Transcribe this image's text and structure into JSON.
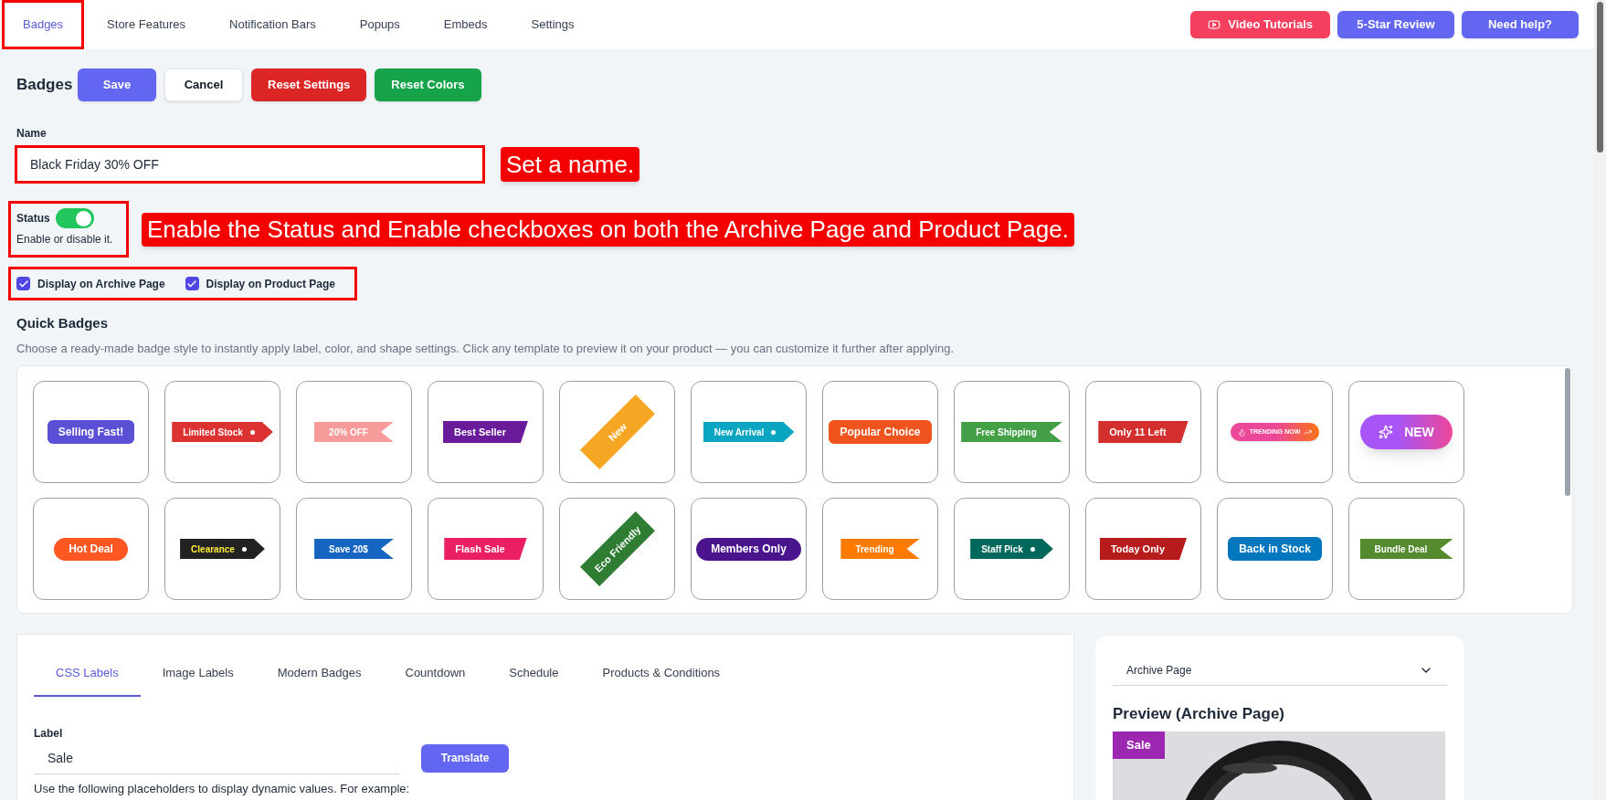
{
  "top_tabs": [
    {
      "label": "Badges",
      "selected": true,
      "highlighted": true
    },
    {
      "label": "Store Features",
      "selected": false,
      "highlighted": false
    },
    {
      "label": "Notification Bars",
      "selected": false,
      "highlighted": false
    },
    {
      "label": "Popups",
      "selected": false,
      "highlighted": false
    },
    {
      "label": "Embeds",
      "selected": false,
      "highlighted": false
    },
    {
      "label": "Settings",
      "selected": false,
      "highlighted": false
    }
  ],
  "top_buttons": [
    {
      "label": "Video Tutorials",
      "kind": "video",
      "color": "#f43f5e"
    },
    {
      "label": "5-Star Review",
      "kind": "plain",
      "color": "#6366f1"
    },
    {
      "label": "Need help?",
      "kind": "plain",
      "color": "#6366f1"
    }
  ],
  "page_title": "Badges",
  "actions": [
    {
      "label": "Save",
      "kind": "primary"
    },
    {
      "label": "Cancel",
      "kind": "secondary"
    },
    {
      "label": "Reset Settings",
      "kind": "danger"
    },
    {
      "label": "Reset Colors",
      "kind": "success"
    }
  ],
  "name_field": {
    "label": "Name",
    "value": "Black Friday 30% OFF",
    "highlighted": true
  },
  "name_callout": "Set a name.",
  "status": {
    "label": "Status",
    "on": true,
    "hint": "Enable or disable it.",
    "highlighted": true
  },
  "status_callout": "Enable the Status and Enable checkboxes on both the Archive Page and Product Page.",
  "display_options": {
    "highlighted": true,
    "items": [
      {
        "label": "Display on Archive Page",
        "checked": true
      },
      {
        "label": "Display on Product Page",
        "checked": true
      }
    ]
  },
  "quick_badges": {
    "title": "Quick Badges",
    "description": "Choose a ready-made badge style to instantly apply label, color, and shape settings. Click any template to preview it on your product — you can customize it further after applying.",
    "badges": [
      {
        "label": "Selling Fast!",
        "kind": "rounded",
        "color": "#5b4fd6"
      },
      {
        "label": "Limited Stock",
        "kind": "tag",
        "color": "#dc3232"
      },
      {
        "label": "20% OFF",
        "kind": "ribbon",
        "color": "#f79a9a"
      },
      {
        "label": "Best Seller",
        "kind": "slant",
        "color": "#6a1b9a"
      },
      {
        "label": "New",
        "kind": "corner",
        "color": "#f5a623"
      },
      {
        "label": "New Arrival",
        "kind": "tag",
        "color": "#0aa5c0"
      },
      {
        "label": "Popular Choice",
        "kind": "rounded",
        "color": "#f0541e"
      },
      {
        "label": "Free Shipping",
        "kind": "ribbon",
        "color": "#43a047"
      },
      {
        "label": "Only 11 Left",
        "kind": "slant",
        "color": "#d32f2f"
      },
      {
        "label": "TRENDING NOW",
        "kind": "gradient",
        "color": "#ec4899"
      },
      {
        "label": "NEW",
        "kind": "glow",
        "color": "#a855f7"
      },
      {
        "label": "Hot Deal",
        "kind": "pill",
        "color": "#ff5722"
      },
      {
        "label": "Clearance",
        "kind": "tag",
        "color": "#222222",
        "text_style": {
          "color": "#ffeb3b"
        }
      },
      {
        "label": "Save 20$",
        "kind": "ribbon",
        "color": "#1565c0"
      },
      {
        "label": "Flash Sale",
        "kind": "slant",
        "color": "#e91e63"
      },
      {
        "label": "Eco Friendly",
        "kind": "corner",
        "color": "#2e7d32"
      },
      {
        "label": "Members Only",
        "kind": "pill",
        "color": "#4a148c"
      },
      {
        "label": "Trending",
        "kind": "ribbon",
        "color": "#ff7b00"
      },
      {
        "label": "Staff Pick",
        "kind": "tag",
        "color": "#00695c"
      },
      {
        "label": "Today Only",
        "kind": "slant",
        "color": "#b71c1c"
      },
      {
        "label": "Back in Stock",
        "kind": "rounded",
        "color": "#0277bd"
      },
      {
        "label": "Bundle Deal",
        "kind": "ribbon",
        "color": "#558b2f"
      }
    ]
  },
  "editor": {
    "tabs": [
      {
        "label": "CSS Labels",
        "selected": true
      },
      {
        "label": "Image Labels",
        "selected": false
      },
      {
        "label": "Modern Badges",
        "selected": false
      },
      {
        "label": "Countdown",
        "selected": false
      },
      {
        "label": "Schedule",
        "selected": false
      },
      {
        "label": "Products & Conditions",
        "selected": false
      }
    ],
    "label_field": {
      "label": "Label",
      "value": "Sale"
    },
    "translate_button": "Translate",
    "help_text": "Use the following placeholders to display dynamic values. For example:"
  },
  "preview": {
    "select": "Archive Page",
    "title": "Preview (Archive Page)",
    "sale_tag": "Sale"
  }
}
